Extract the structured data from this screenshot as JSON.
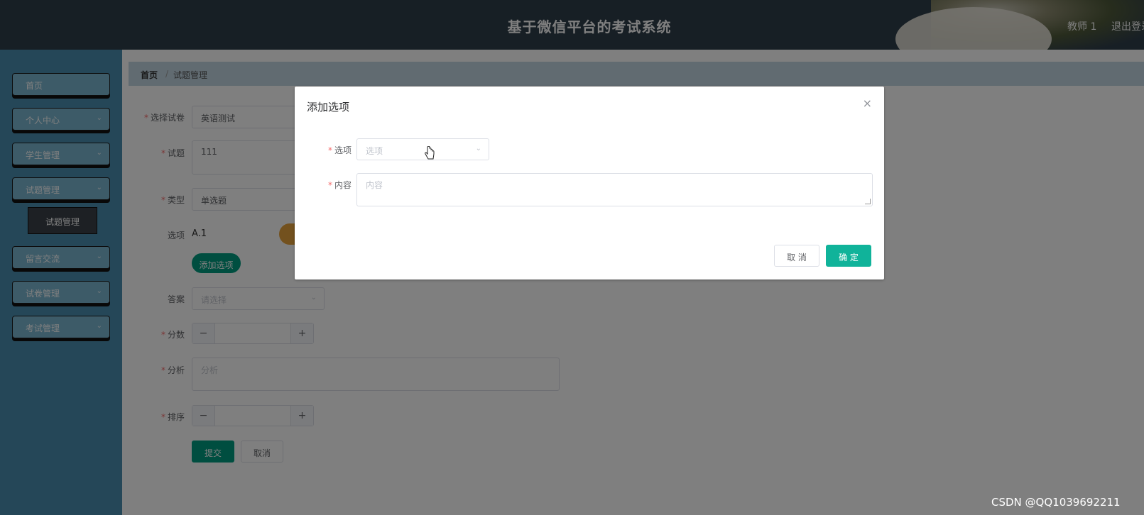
{
  "header": {
    "title": "基于微信平台的考试系统",
    "user": "教师 1",
    "logout": "退出登录"
  },
  "sidebar": {
    "items": [
      {
        "label": "首页",
        "has_arrow": false
      },
      {
        "label": "个人中心",
        "has_arrow": true
      },
      {
        "label": "学生管理",
        "has_arrow": true
      },
      {
        "label": "试题管理",
        "has_arrow": true
      },
      {
        "label": "留言交流",
        "has_arrow": true
      },
      {
        "label": "试卷管理",
        "has_arrow": true
      },
      {
        "label": "考试管理",
        "has_arrow": true
      }
    ],
    "submenu_label": "试题管理"
  },
  "breadcrumb": {
    "home": "首页",
    "separator": "/",
    "current": "试题管理"
  },
  "form": {
    "paper": {
      "label": "选择试卷",
      "value": "英语测试"
    },
    "question": {
      "label": "试题",
      "value": "111"
    },
    "type": {
      "label": "类型",
      "value": "单选题"
    },
    "options": {
      "label": "选项",
      "items": [
        "A.1"
      ],
      "add_button": "添加选项"
    },
    "answer": {
      "label": "答案",
      "placeholder": "请选择"
    },
    "score": {
      "label": "分数",
      "minus": "−",
      "plus": "+"
    },
    "analysis": {
      "label": "分析",
      "placeholder": "分析"
    },
    "sort": {
      "label": "排序",
      "minus": "−",
      "plus": "+"
    },
    "submit": "提交",
    "cancel": "取消"
  },
  "dialog": {
    "title": "添加选项",
    "close": "×",
    "option_label": "选项",
    "option_placeholder": "选项",
    "content_label": "内容",
    "content_placeholder": "内容",
    "cancel": "取 消",
    "confirm": "确 定"
  },
  "watermark": "CSDN @QQ1039692211",
  "colors": {
    "header_bg": "#2f3e4b",
    "sidebar_bg": "#4a8fb0",
    "primary": "#009d80",
    "required": "#f56c6c"
  },
  "icons": {
    "select_arrow": "chevron-down-icon",
    "close": "close-icon",
    "cursor": "hand-pointer-icon"
  }
}
